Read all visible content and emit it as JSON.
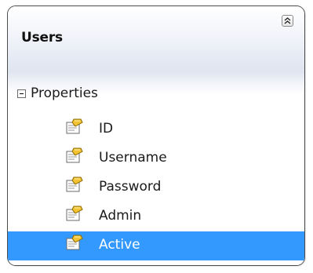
{
  "entity": {
    "title": "Users",
    "collapse_icon": "double-chevron-up-icon"
  },
  "section": {
    "label": "Properties",
    "expander_icon": "collapse-minus-icon",
    "state": "expanded"
  },
  "properties": [
    {
      "label": "ID",
      "icon": "property-icon",
      "selected": false
    },
    {
      "label": "Username",
      "icon": "property-icon",
      "selected": false
    },
    {
      "label": "Password",
      "icon": "property-icon",
      "selected": false
    },
    {
      "label": "Admin",
      "icon": "property-icon",
      "selected": false
    },
    {
      "label": "Active",
      "icon": "property-icon",
      "selected": true
    }
  ],
  "colors": {
    "selection": "#3399ff",
    "header_gradient_bottom": "#dfe4f0",
    "border": "#4b4b4b"
  }
}
